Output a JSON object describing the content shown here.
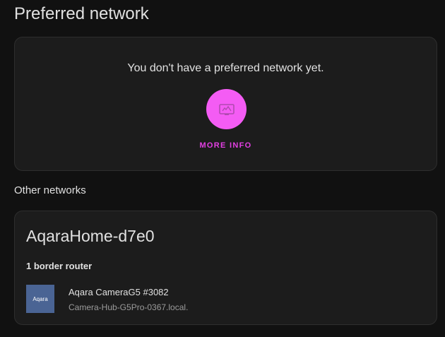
{
  "preferred": {
    "title": "Preferred network",
    "empty_text": "You don't have a preferred network yet.",
    "icon": "network-icon",
    "more_info_label": "MORE INFO",
    "accent_color": "#f45cf4"
  },
  "other": {
    "title": "Other networks",
    "network": {
      "name": "AqaraHome-d7e0",
      "router_count": "1 border router",
      "device": {
        "logo_text": "Aqara",
        "name": "Aqara CameraG5 #3082",
        "host": "Camera-Hub-G5Pro-0367.local."
      }
    }
  }
}
